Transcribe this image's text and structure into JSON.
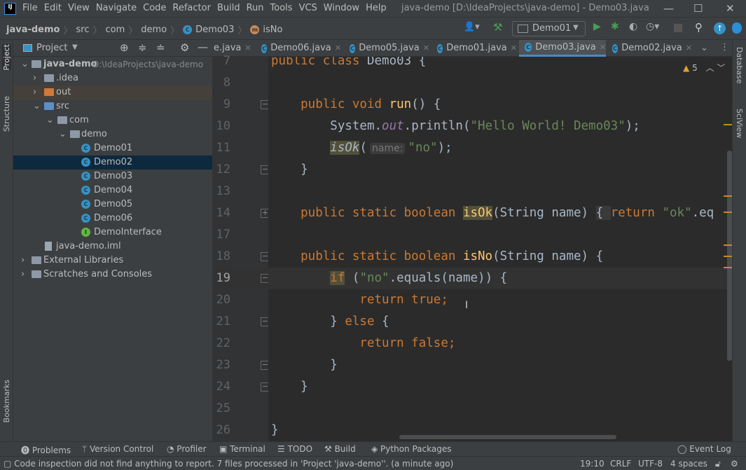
{
  "title_bar": {
    "logo": "IJ",
    "menu": [
      "File",
      "Edit",
      "View",
      "Navigate",
      "Code",
      "Refactor",
      "Build",
      "Run",
      "Tools",
      "VCS",
      "Window",
      "Help"
    ],
    "window_title": "java-demo [D:\\IdeaProjects\\java-demo] - Demo03.java"
  },
  "breadcrumb": [
    "java-demo",
    "src",
    "com",
    "demo",
    "Demo03",
    "isNo"
  ],
  "toolbar": {
    "run_config": "Demo01"
  },
  "left_strip": [
    "Project",
    "Structure",
    "Bookmarks"
  ],
  "right_strip": [
    "Database",
    "SciView"
  ],
  "project": {
    "title": "Project",
    "tree": [
      {
        "label": "java-demo",
        "hint": "D:\\IdeaProjects\\java-demo",
        "level": 0,
        "arrow": "down",
        "icon": "module"
      },
      {
        "label": ".idea",
        "level": 1,
        "arrow": "right",
        "icon": "folder"
      },
      {
        "label": "out",
        "level": 1,
        "arrow": "right",
        "icon": "folder-orange"
      },
      {
        "label": "src",
        "level": 1,
        "arrow": "down",
        "icon": "folder-blue"
      },
      {
        "label": "com",
        "level": 2,
        "arrow": "down",
        "icon": "package"
      },
      {
        "label": "demo",
        "level": 3,
        "arrow": "down",
        "icon": "package"
      },
      {
        "label": "Demo01",
        "level": 4,
        "icon": "class"
      },
      {
        "label": "Demo02",
        "level": 4,
        "icon": "class",
        "selected": true
      },
      {
        "label": "Demo03",
        "level": 4,
        "icon": "class"
      },
      {
        "label": "Demo04",
        "level": 4,
        "icon": "class"
      },
      {
        "label": "Demo05",
        "level": 4,
        "icon": "class"
      },
      {
        "label": "Demo06",
        "level": 4,
        "icon": "class"
      },
      {
        "label": "DemoInterface",
        "level": 4,
        "icon": "interface"
      },
      {
        "label": "java-demo.iml",
        "level": 1,
        "icon": "file"
      },
      {
        "label": "External Libraries",
        "level": 0,
        "arrow": "right",
        "icon": "library"
      },
      {
        "label": "Scratches and Consoles",
        "level": 0,
        "arrow": "right",
        "icon": "scratch"
      }
    ]
  },
  "tabs": [
    {
      "label": "e.java"
    },
    {
      "label": "Demo06.java"
    },
    {
      "label": "Demo05.java"
    },
    {
      "label": "Demo01.java"
    },
    {
      "label": "Demo03.java",
      "active": true
    },
    {
      "label": "Demo02.java"
    }
  ],
  "editor": {
    "warnings": "5",
    "current_line": 19,
    "lines": [
      {
        "n": "7",
        "t": [
          [
            "public class ",
            "k"
          ],
          [
            "Demo03 {",
            "t"
          ]
        ]
      },
      {
        "n": "8",
        "t": []
      },
      {
        "n": "9",
        "fold": "-",
        "t": [
          [
            "    public void ",
            "k"
          ],
          [
            "run",
            "m"
          ],
          [
            "() {",
            "t"
          ]
        ]
      },
      {
        "n": "10",
        "t": [
          [
            "        System.",
            "t"
          ],
          [
            "out",
            "f"
          ],
          [
            ".println(",
            "t"
          ],
          [
            "\"Hello World! Demo03\"",
            "s"
          ],
          [
            ");",
            "t"
          ]
        ]
      },
      {
        "n": "11",
        "t": [
          [
            "        ",
            "t"
          ],
          [
            "isOk",
            "it hl"
          ],
          [
            "(",
            "t"
          ],
          [
            "name:",
            "hint"
          ],
          [
            "\"no\"",
            "s"
          ],
          [
            ");",
            "t"
          ]
        ]
      },
      {
        "n": "12",
        "fold": "-",
        "t": [
          [
            "    }",
            "t"
          ]
        ]
      },
      {
        "n": "13",
        "t": []
      },
      {
        "n": "14",
        "fold": "+",
        "t": [
          [
            "    public static boolean ",
            "k"
          ],
          [
            "isOk",
            "m hl"
          ],
          [
            "(String name) ",
            "t"
          ],
          [
            "{ ",
            "folded"
          ],
          [
            "return ",
            "k"
          ],
          [
            "\"ok\"",
            "s"
          ],
          [
            ".eq",
            "t"
          ]
        ]
      },
      {
        "n": "17",
        "t": []
      },
      {
        "n": "18",
        "fold": "-",
        "t": [
          [
            "    public static boolean ",
            "k"
          ],
          [
            "isNo",
            "m"
          ],
          [
            "(String name) {",
            "t"
          ]
        ]
      },
      {
        "n": "19",
        "fold": "-",
        "t": [
          [
            "        ",
            "t"
          ],
          [
            "if",
            "k hl"
          ],
          [
            " (",
            "t"
          ],
          [
            "\"no\"",
            "s"
          ],
          [
            ".equals(name)) {",
            "t"
          ]
        ]
      },
      {
        "n": "20",
        "t": [
          [
            "            return true",
            "k"
          ],
          [
            ";",
            "k"
          ]
        ]
      },
      {
        "n": "21",
        "fold": "-",
        "t": [
          [
            "        } ",
            "t"
          ],
          [
            "else ",
            "k"
          ],
          [
            "{",
            "t"
          ]
        ]
      },
      {
        "n": "22",
        "t": [
          [
            "            return false",
            "k"
          ],
          [
            ";",
            "k"
          ]
        ]
      },
      {
        "n": "23",
        "fold": "-",
        "t": [
          [
            "        }",
            "t"
          ]
        ]
      },
      {
        "n": "24",
        "fold": "-",
        "t": [
          [
            "    }",
            "t"
          ]
        ]
      },
      {
        "n": "25",
        "t": []
      },
      {
        "n": "26",
        "t": [
          [
            "}",
            "t"
          ]
        ]
      }
    ]
  },
  "tool_windows": [
    "Problems",
    "Version Control",
    "Profiler",
    "Terminal",
    "TODO",
    "Build",
    "Python Packages"
  ],
  "event_log": "Event Log",
  "status": {
    "message": "Code inspection did not find anything to report. 7 files processed in 'Project 'java-demo''. (a minute ago)",
    "position": "19:10",
    "line_sep": "CRLF",
    "encoding": "UTF-8",
    "indent": "4 spaces"
  }
}
